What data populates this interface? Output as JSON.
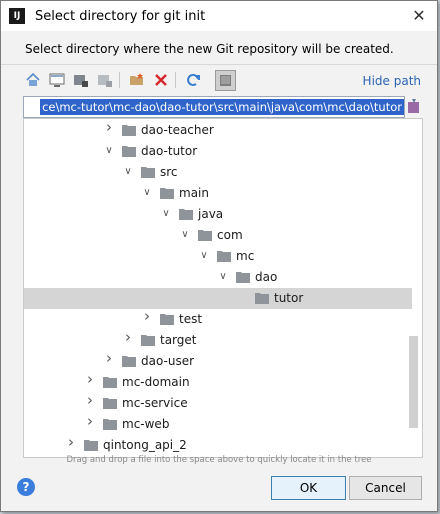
{
  "window": {
    "title": "Select directory for git init",
    "app_icon_text": "IJ"
  },
  "description": "Select directory where the new Git repository will be created.",
  "toolbar": {
    "buttons": [
      {
        "name": "home-icon"
      },
      {
        "name": "desktop-icon"
      },
      {
        "name": "project-icon"
      },
      {
        "name": "module-icon"
      },
      {
        "name": "new-folder-icon"
      },
      {
        "name": "delete-icon"
      },
      {
        "name": "refresh-icon"
      },
      {
        "name": "show-hidden-icon"
      }
    ],
    "hide_path_label": "Hide path"
  },
  "path": {
    "value": "ce\\mc-tutor\\mc-dao\\dao-tutor\\src\\main\\java\\com\\mc\\dao\\tutor"
  },
  "tree": {
    "rows": [
      {
        "label": "dao-teacher",
        "depth": 4,
        "expanded": false,
        "selected": false
      },
      {
        "label": "dao-tutor",
        "depth": 4,
        "expanded": true,
        "selected": false
      },
      {
        "label": "src",
        "depth": 5,
        "expanded": true,
        "selected": false
      },
      {
        "label": "main",
        "depth": 6,
        "expanded": true,
        "selected": false
      },
      {
        "label": "java",
        "depth": 7,
        "expanded": true,
        "selected": false
      },
      {
        "label": "com",
        "depth": 8,
        "expanded": true,
        "selected": false
      },
      {
        "label": "mc",
        "depth": 9,
        "expanded": true,
        "selected": false
      },
      {
        "label": "dao",
        "depth": 10,
        "expanded": true,
        "selected": false
      },
      {
        "label": "tutor",
        "depth": 11,
        "expanded": null,
        "selected": true
      },
      {
        "label": "test",
        "depth": 6,
        "expanded": false,
        "selected": false
      },
      {
        "label": "target",
        "depth": 5,
        "expanded": false,
        "selected": false
      },
      {
        "label": "dao-user",
        "depth": 4,
        "expanded": false,
        "selected": false
      },
      {
        "label": "mc-domain",
        "depth": 3,
        "expanded": false,
        "selected": false
      },
      {
        "label": "mc-service",
        "depth": 3,
        "expanded": false,
        "selected": false
      },
      {
        "label": "mc-web",
        "depth": 3,
        "expanded": false,
        "selected": false
      },
      {
        "label": "qintong_api_2",
        "depth": 2,
        "expanded": false,
        "selected": false
      }
    ]
  },
  "hint": "Drag and drop a file into the space above to quickly locate it in the tree",
  "buttons": {
    "ok": "OK",
    "cancel": "Cancel",
    "help": "?"
  },
  "colors": {
    "selection": "#2f65ca",
    "link": "#2a64b4",
    "folder": "#8e949a"
  }
}
